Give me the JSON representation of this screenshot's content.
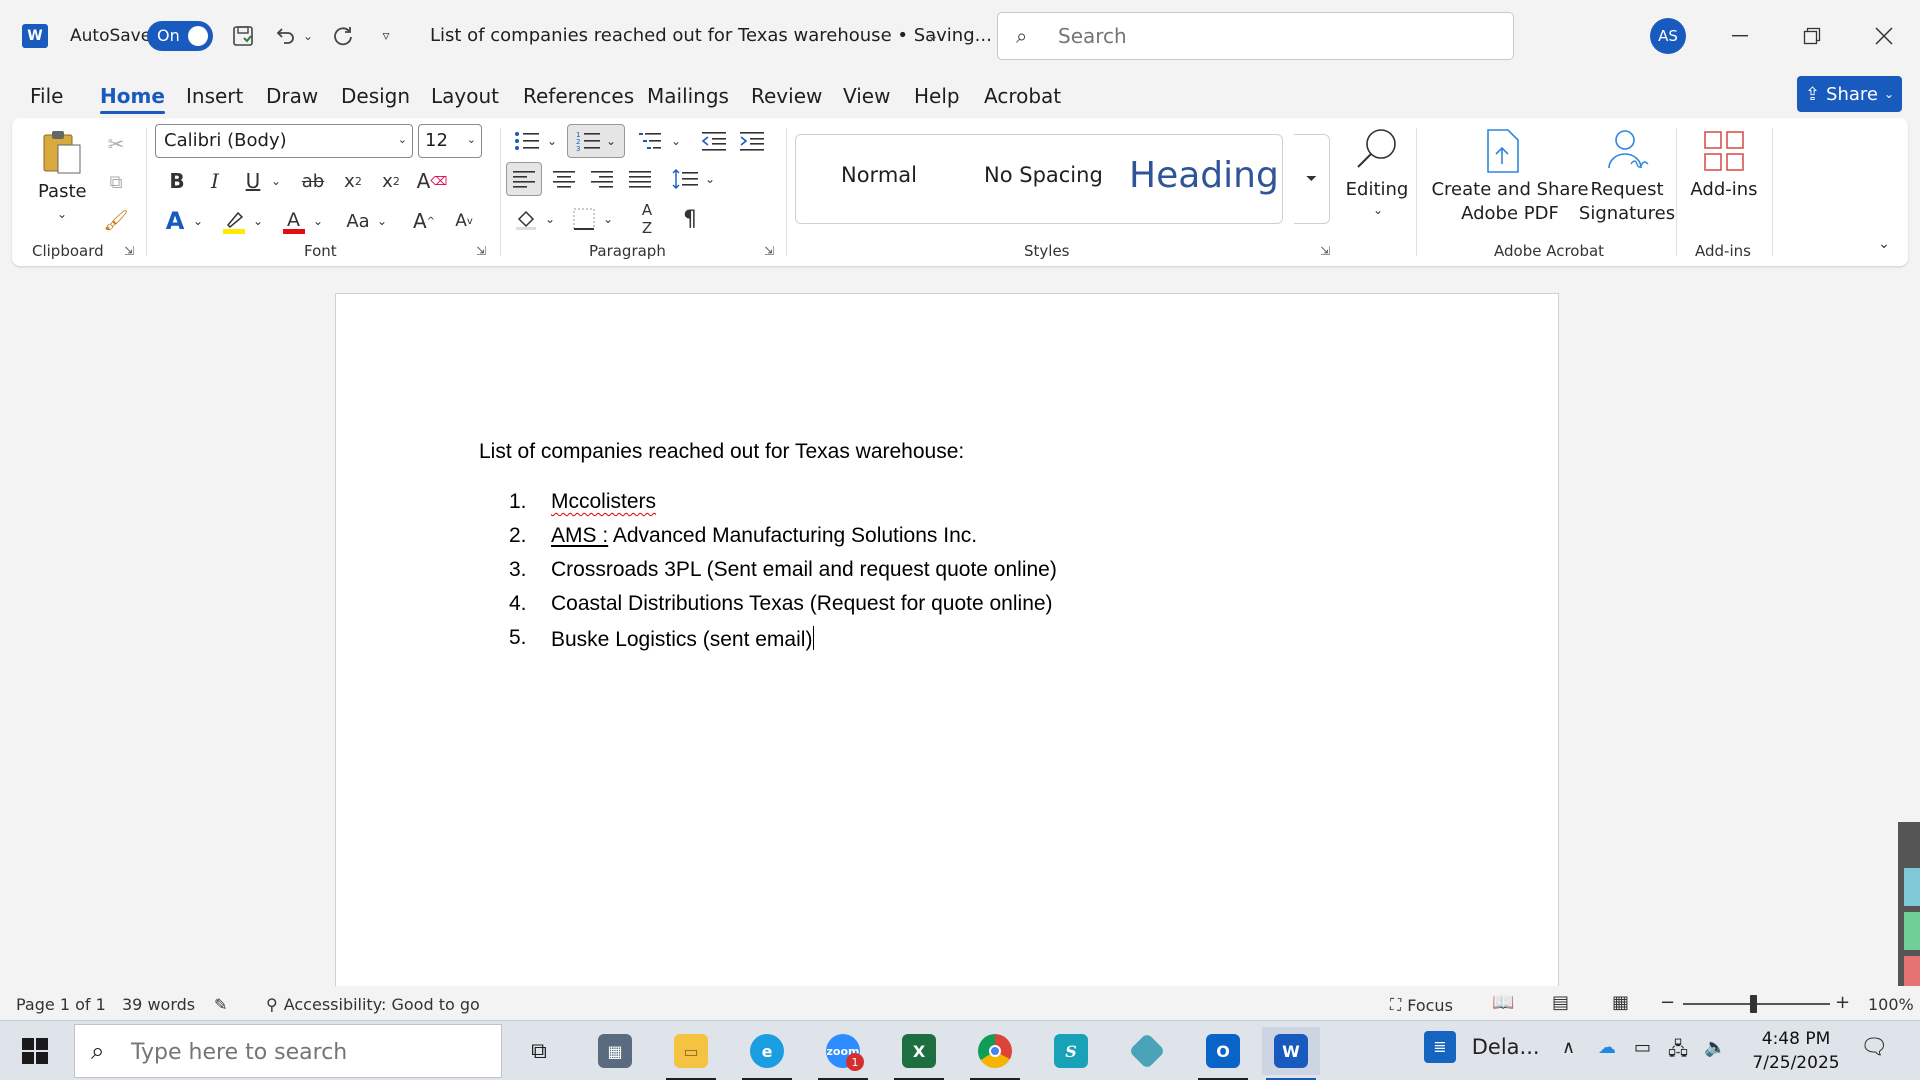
{
  "titlebar": {
    "app_logo": "W",
    "autosave_label": "AutoSave",
    "autosave_state": "On",
    "doc_title": "List of companies reached out for Texas warehouse • Saving...",
    "search_placeholder": "Search",
    "avatar_initials": "AS"
  },
  "menu": {
    "tabs": [
      "File",
      "Home",
      "Insert",
      "Draw",
      "Design",
      "Layout",
      "References",
      "Mailings",
      "Review",
      "View",
      "Help",
      "Acrobat"
    ],
    "active": "Home",
    "share_label": "Share"
  },
  "ribbon": {
    "clipboard": {
      "paste_label": "Paste",
      "group_label": "Clipboard"
    },
    "font": {
      "font_name": "Calibri (Body)",
      "font_size": "12",
      "group_label": "Font"
    },
    "paragraph": {
      "group_label": "Paragraph"
    },
    "styles": {
      "normal": "Normal",
      "no_spacing": "No Spacing",
      "heading": "Heading",
      "group_label": "Styles"
    },
    "editing": {
      "label": "Editing"
    },
    "acrobat": {
      "create_share_line1": "Create and Share",
      "create_share_line2": "Adobe PDF",
      "request_line1": "Request",
      "request_line2": "Signatures",
      "group_label": "Adobe Acrobat"
    },
    "addins": {
      "label": "Add-ins",
      "group_label": "Add-ins"
    }
  },
  "document": {
    "heading": "List of companies reached out for Texas warehouse:",
    "items": [
      {
        "num": "1.",
        "text": "Mccolisters"
      },
      {
        "num": "2.",
        "prefix": "AMS :",
        "text": " Advanced Manufacturing Solutions Inc."
      },
      {
        "num": "3.",
        "text": "Crossroads 3PL (Sent email and request quote online)"
      },
      {
        "num": "4.",
        "text": "Coastal Distributions Texas (Request for quote online)"
      },
      {
        "num": "5.",
        "text": "Buske Logistics (sent email)"
      }
    ]
  },
  "statusbar": {
    "page": "Page 1 of 1",
    "words": "39 words",
    "accessibility": "Accessibility: Good to go",
    "focus": "Focus",
    "zoom": "100%"
  },
  "taskbar": {
    "search_placeholder": "Type here to search",
    "zoom_badge": "1",
    "weather": "Dela...",
    "time": "4:48 PM",
    "date": "7/25/2025"
  },
  "colors": {
    "accent": "#185abd",
    "heading_style": "#2f5597",
    "spell_error": "#e00000"
  }
}
